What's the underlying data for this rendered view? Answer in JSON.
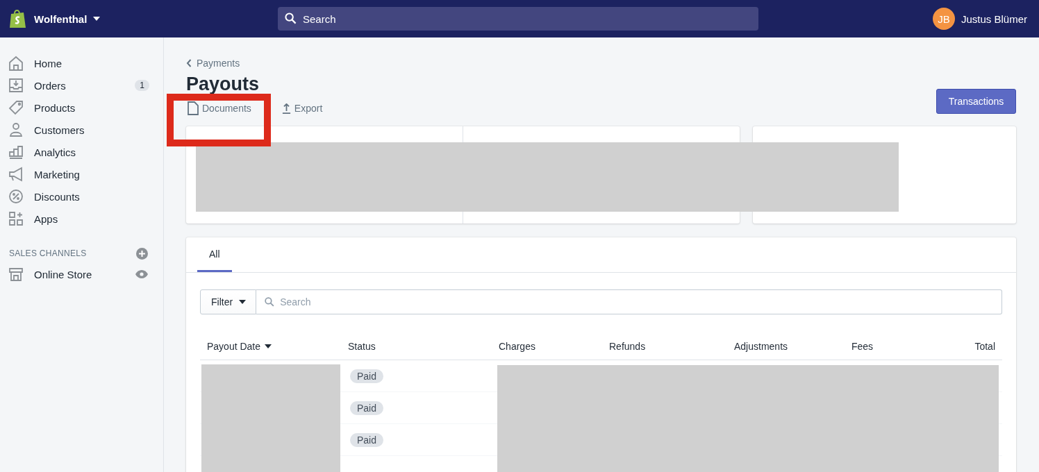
{
  "topbar": {
    "store_name": "Wolfenthal",
    "search": {
      "placeholder": "Search"
    },
    "user": {
      "initials": "JB",
      "name": "Justus Blümer"
    }
  },
  "sidebar": {
    "items": [
      {
        "label": "Home"
      },
      {
        "label": "Orders",
        "badge": "1"
      },
      {
        "label": "Products"
      },
      {
        "label": "Customers"
      },
      {
        "label": "Analytics"
      },
      {
        "label": "Marketing"
      },
      {
        "label": "Discounts"
      },
      {
        "label": "Apps"
      }
    ],
    "sales_channels": {
      "heading": "SALES CHANNELS",
      "items": [
        {
          "label": "Online Store"
        }
      ]
    }
  },
  "page": {
    "breadcrumb": "Payments",
    "title": "Payouts",
    "actions": [
      "Documents",
      "Export"
    ],
    "primary_button": "Transactions"
  },
  "tabs": [
    {
      "label": "All",
      "selected": true
    }
  ],
  "filter": {
    "button": "Filter",
    "search_placeholder": "Search"
  },
  "table": {
    "columns": [
      {
        "label": "Payout Date",
        "sorted": true
      },
      {
        "label": "Status",
        "sorted": false
      },
      {
        "label": "Charges",
        "sorted": false
      },
      {
        "label": "Refunds",
        "sorted": false
      },
      {
        "label": "Adjustments",
        "sorted": false
      },
      {
        "label": "Fees",
        "sorted": false
      },
      {
        "label": "Total",
        "sorted": false
      }
    ],
    "rows": [
      {
        "status": "Paid"
      },
      {
        "status": "Paid"
      },
      {
        "status": "Paid"
      }
    ]
  }
}
